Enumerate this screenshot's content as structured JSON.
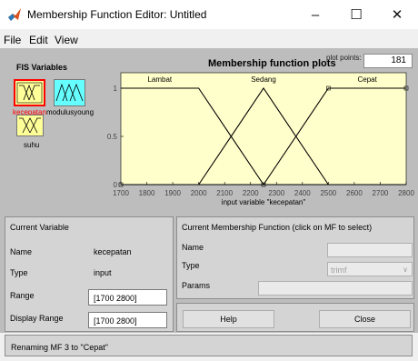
{
  "window": {
    "title": "Membership Function Editor: Untitled",
    "minimize_glyph": "–",
    "maximize_glyph": "☐",
    "close_glyph": "✕"
  },
  "menu": [
    "File",
    "Edit",
    "View"
  ],
  "fis_variables": {
    "heading": "FIS Variables",
    "items": [
      {
        "name": "kecepatan",
        "selected": true,
        "color": "#ffff99",
        "label_color": "#ff0000"
      },
      {
        "name": "modulusyoung",
        "selected": false,
        "color": "#66ffff",
        "label_color": "#000000"
      },
      {
        "name": "suhu",
        "selected": false,
        "color": "#ffff99",
        "label_color": "#000000"
      }
    ]
  },
  "plot": {
    "title": "Membership function plots",
    "plot_points_label": "plot points:",
    "plot_points_value": "181"
  },
  "chart_data": {
    "type": "line",
    "xlabel": "input variable \"kecepatan\"",
    "ylabel": "",
    "xlim": [
      1700,
      2800
    ],
    "ylim": [
      0,
      1
    ],
    "x_ticks": [
      "1700",
      "1800",
      "1900",
      "2000",
      "2100",
      "2200",
      "2300",
      "2400",
      "2500",
      "2600",
      "2700",
      "2800"
    ],
    "y_ticks": [
      "0",
      "0.5",
      "1"
    ],
    "background": "#ffffcc",
    "series": [
      {
        "name": "Lambat",
        "color": "#000000",
        "points": [
          [
            1700,
            1
          ],
          [
            2000,
            1
          ],
          [
            2250,
            0
          ],
          [
            2800,
            0
          ]
        ]
      },
      {
        "name": "Sedang",
        "color": "#000000",
        "points": [
          [
            1700,
            0
          ],
          [
            2000,
            0
          ],
          [
            2250,
            1
          ],
          [
            2500,
            0
          ],
          [
            2800,
            0
          ]
        ]
      },
      {
        "name": "Cepat",
        "color": "#000000",
        "points": [
          [
            1700,
            0
          ],
          [
            2250,
            0
          ],
          [
            2500,
            1
          ],
          [
            2800,
            1
          ]
        ]
      }
    ]
  },
  "current_variable": {
    "heading": "Current Variable",
    "name_label": "Name",
    "name_value": "kecepatan",
    "type_label": "Type",
    "type_value": "input",
    "range_label": "Range",
    "range_value": "[1700 2800]",
    "display_range_label": "Display Range",
    "display_range_value": "[1700 2800]"
  },
  "current_mf": {
    "heading": "Current Membership Function (click on MF to select)",
    "name_label": "Name",
    "name_value": "",
    "type_label": "Type",
    "type_value": "trimf",
    "params_label": "Params",
    "params_value": ""
  },
  "buttons": {
    "help": "Help",
    "close": "Close"
  },
  "status": "Renaming MF 3 to \"Cepat\""
}
